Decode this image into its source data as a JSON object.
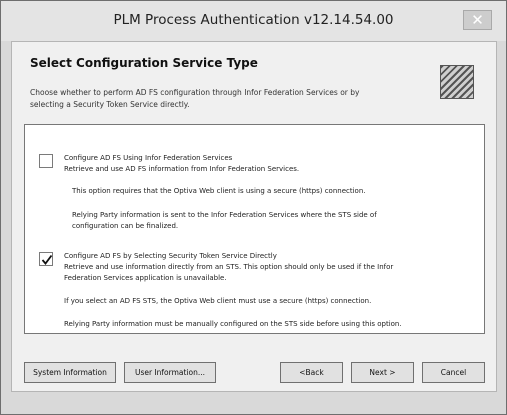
{
  "window": {
    "title": "PLM Process Authentication v12.14.54.00",
    "close_glyph": "✕"
  },
  "header": {
    "title": "Select Configuration Service Type",
    "desc_line1": "Choose whether to perform AD FS configuration through Infor Federation Services or by",
    "desc_line2": "selecting a Security Token Service directly."
  },
  "options": [
    {
      "checked": false,
      "label": "Configure AD FS Using Infor Federation Services",
      "line1": "Retrieve and use AD FS information from Infor Federation Services.",
      "line2": "This option requires that the Optiva Web client is using a secure (https) connection.",
      "line3a": "Relying Party information is sent to the Infor Federation Services where the STS side of",
      "line3b": "configuration can be finalized."
    },
    {
      "checked": true,
      "label": "Configure AD FS by Selecting Security Token Service Directly",
      "line1a": "Retrieve and use information directly from an STS. This option should only be used if the Infor",
      "line1b": "Federation Services application is unavailable.",
      "line2": "If you select an AD FS STS, the Optiva Web client must use a secure (https) connection.",
      "line3": "Relying Party information must be manually configured on the STS side before using this option."
    }
  ],
  "buttons": {
    "system_info": "System Information",
    "user_info": "User Information...",
    "back": "<Back",
    "next": "Next >",
    "cancel": "Cancel"
  },
  "icons": {
    "close": "close-icon",
    "checkmark": "checkmark-icon",
    "logo": "logo-icon"
  }
}
